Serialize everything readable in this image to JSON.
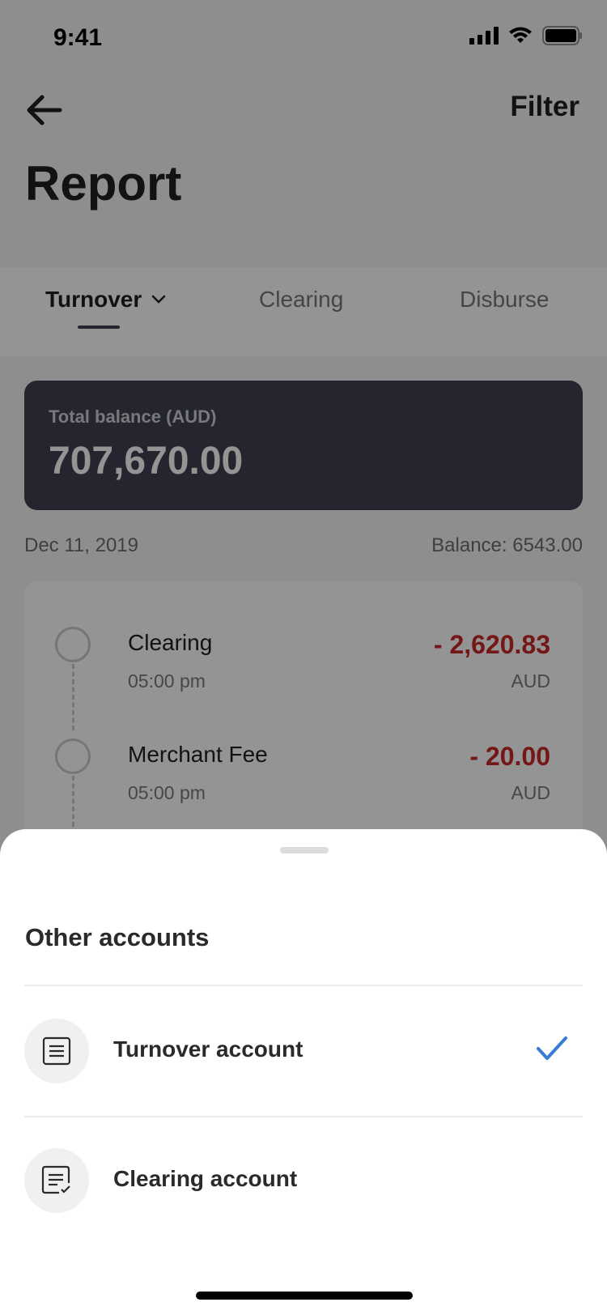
{
  "status_bar": {
    "time": "9:41"
  },
  "header": {
    "filter_label": "Filter",
    "title": "Report"
  },
  "tabs": [
    {
      "label": "Turnover",
      "active": true
    },
    {
      "label": "Clearing",
      "active": false
    },
    {
      "label": "Disburse",
      "active": false
    }
  ],
  "balance_card": {
    "label": "Total balance (AUD)",
    "value": "707,670.00"
  },
  "date_row": {
    "date": "Dec 11, 2019",
    "balance": "Balance: 6543.00"
  },
  "transactions": [
    {
      "title": "Clearing",
      "time": "05:00 pm",
      "amount": "- 2,620.83",
      "currency": "AUD"
    },
    {
      "title": "Merchant Fee",
      "time": "05:00 pm",
      "amount": "- 20.00",
      "currency": "AUD"
    }
  ],
  "sheet": {
    "title": "Other accounts",
    "options": [
      {
        "label": "Turnover account",
        "selected": true,
        "icon": "document-icon"
      },
      {
        "label": "Clearing account",
        "selected": false,
        "icon": "document-check-icon"
      }
    ]
  },
  "colors": {
    "accent": "#3a7bd5",
    "negative": "#c62828",
    "card": "#3e4152"
  }
}
